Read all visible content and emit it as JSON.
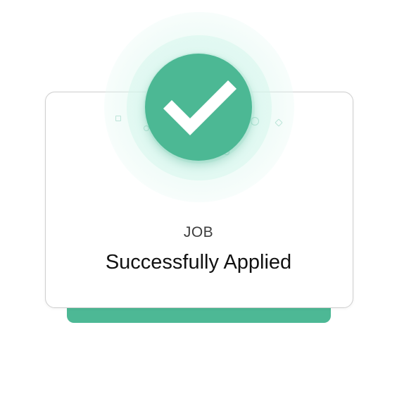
{
  "dialog": {
    "category": "JOB",
    "status": "Successfully Applied",
    "icon": "checkmark-icon"
  },
  "colors": {
    "accent": "#4cb894",
    "base_bar": "#4db895",
    "halo": "#d6f5ec",
    "card_border": "#cfcfcf",
    "text_primary": "#111111",
    "text_secondary": "#3d3d3d"
  }
}
